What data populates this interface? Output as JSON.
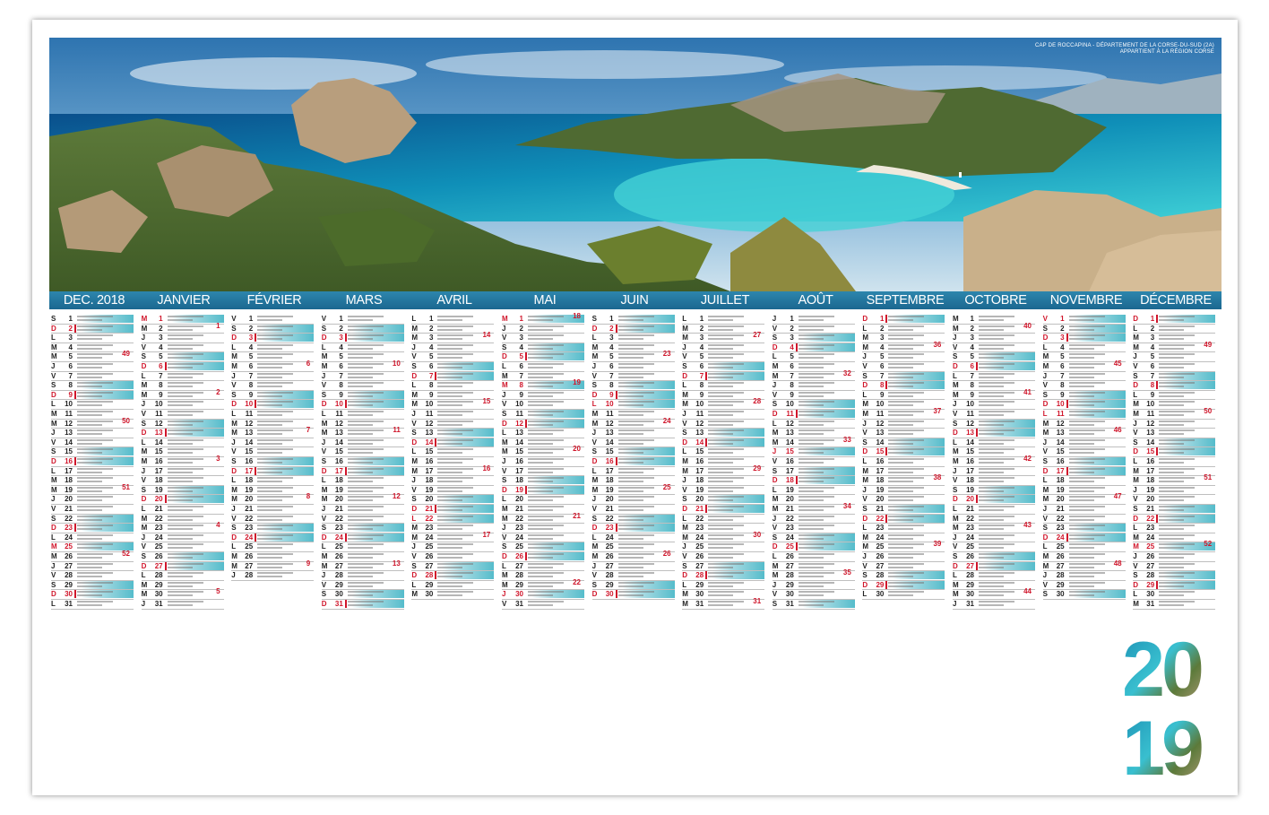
{
  "photo": {
    "credit_line1": "CAP DE ROCCAPINA - DÉPARTEMENT DE LA CORSE-DU-SUD (2A)",
    "credit_line2": "APPARTIENT À LA RÉGION CORSE"
  },
  "months": [
    "DEC. 2018",
    "JANVIER",
    "FÉVRIER",
    "MARS",
    "AVRIL",
    "MAI",
    "JUIN",
    "JUILLET",
    "AOÛT",
    "SEPTEMBRE",
    "OCTOBRE",
    "NOVEMBRE",
    "DÉCEMBRE"
  ],
  "year": "2019",
  "colors": {
    "header": "#1f6f98",
    "sunday": "#d0162b",
    "weekend_band": "#55bccb"
  }
}
